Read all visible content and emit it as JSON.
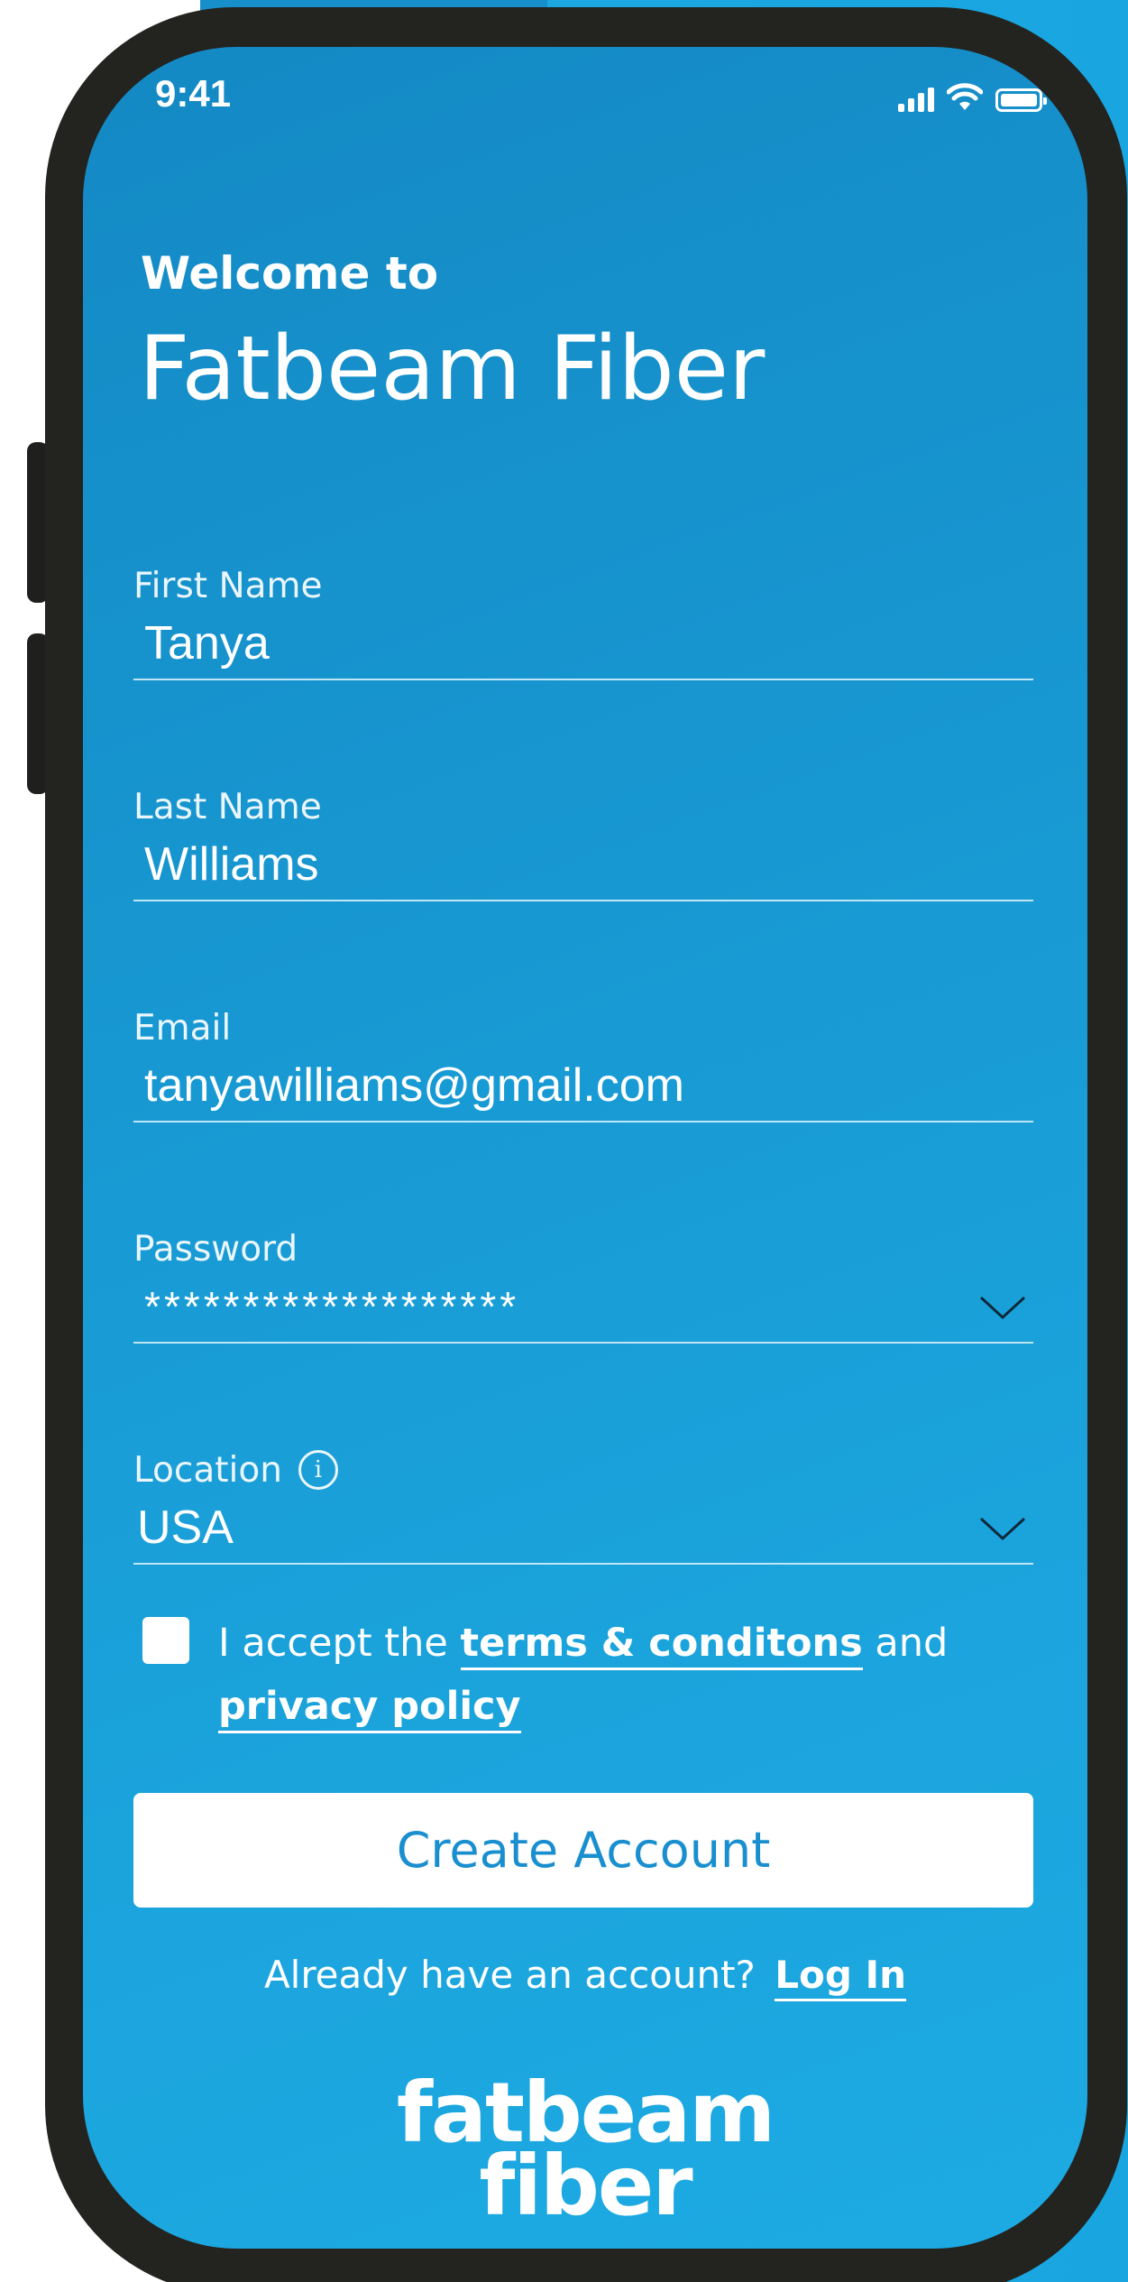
{
  "status_bar": {
    "time": "9:41",
    "icons": [
      "cellular-signal-icon",
      "wifi-icon",
      "battery-icon"
    ]
  },
  "header": {
    "welcome": "Welcome to",
    "title": "Fatbeam Fiber"
  },
  "form": {
    "first_name": {
      "label": "First Name",
      "value": "Tanya"
    },
    "last_name": {
      "label": "Last Name",
      "value": "Williams"
    },
    "email": {
      "label": "Email",
      "value": "tanyawilliams@gmail.com"
    },
    "password": {
      "label": "Password",
      "value": "*******************"
    },
    "location": {
      "label": "Location",
      "value": "USA",
      "info_icon": "info-icon"
    }
  },
  "terms": {
    "checked": false,
    "prefix": "I accept the",
    "terms_link": "terms & conditons",
    "middle": "and",
    "privacy_link": "privacy policy"
  },
  "actions": {
    "create_account": "Create Account",
    "login_prompt": "Already have an account?",
    "login_link": "Log In"
  },
  "logo": {
    "line1": "fatbeam",
    "line2": "fiber"
  },
  "colors": {
    "screen_gradient_start": "#1489c4",
    "screen_gradient_end": "#1daae2",
    "phone_frame": "#232320",
    "button_text": "#1a8fcf",
    "white": "#ffffff"
  }
}
